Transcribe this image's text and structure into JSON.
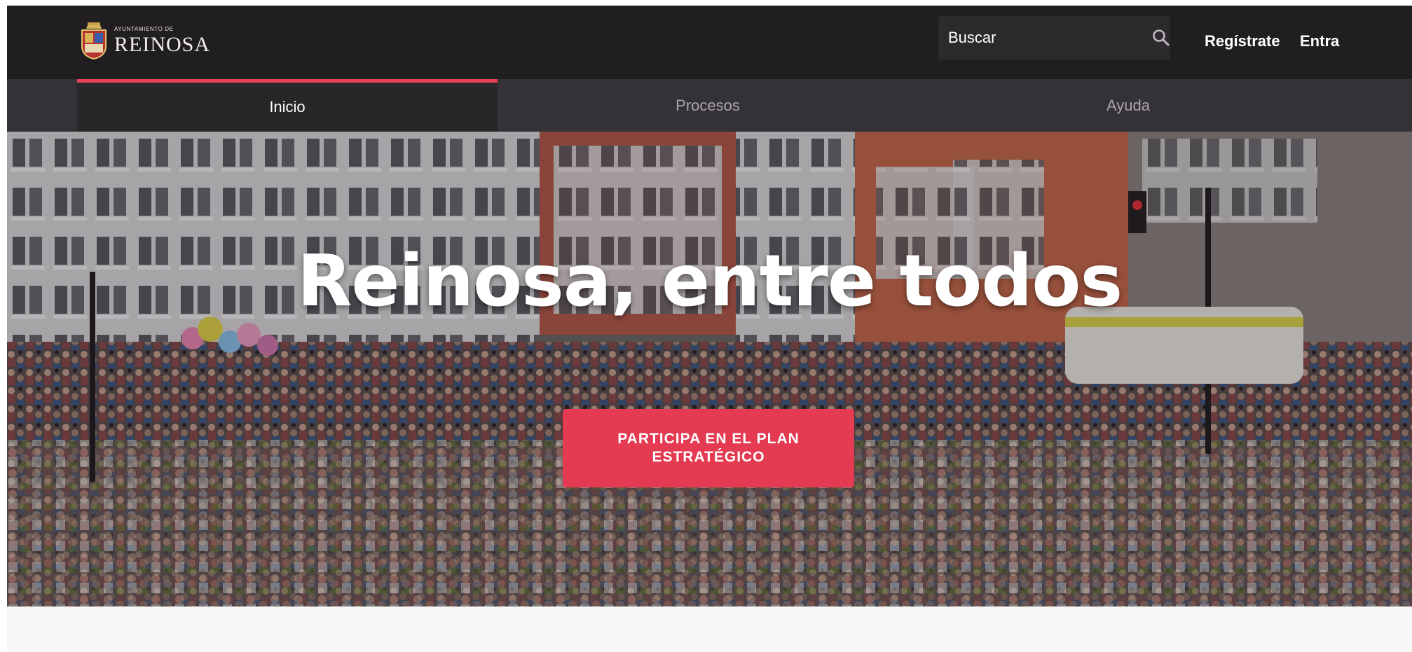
{
  "header": {
    "logo": {
      "small_text": "Ayuntamiento de",
      "big_text": "REINOSA"
    },
    "search": {
      "placeholder": "Buscar",
      "icon": "search-icon"
    },
    "register_label": "Regístrate",
    "login_label": "Entra"
  },
  "nav": {
    "tabs": [
      {
        "label": "Inicio",
        "active": true
      },
      {
        "label": "Procesos",
        "active": false
      },
      {
        "label": "Ayuda",
        "active": false
      }
    ]
  },
  "hero": {
    "title": "Reinosa, entre todos",
    "cta_label": "PARTICIPA EN EL PLAN ESTRATÉGICO"
  },
  "colors": {
    "header_bg": "#211e22",
    "nav_bg": "#353237",
    "accent": "#e43a52"
  }
}
